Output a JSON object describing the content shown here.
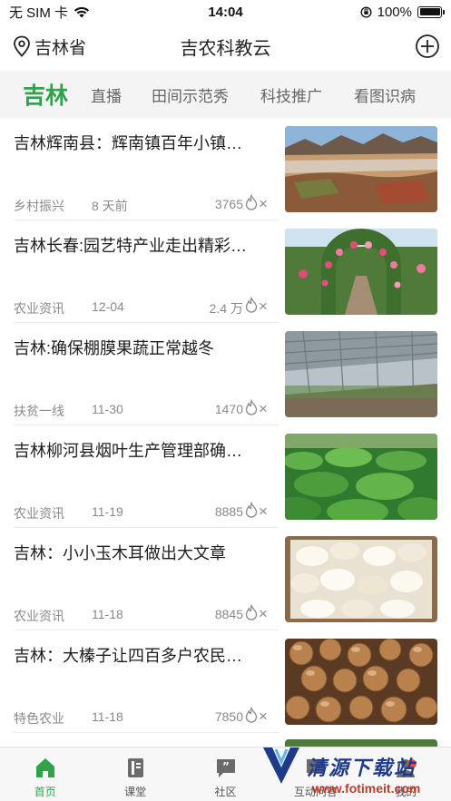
{
  "status_bar": {
    "carrier": "无 SIM 卡",
    "time": "14:04",
    "battery": "100%"
  },
  "header": {
    "location": "吉林省",
    "title": "吉农科教云"
  },
  "tabs": [
    {
      "label": "吉林",
      "active": true
    },
    {
      "label": "直播",
      "active": false
    },
    {
      "label": "田间示范秀",
      "active": false
    },
    {
      "label": "科技推广",
      "active": false
    },
    {
      "label": "看图识病",
      "active": false
    }
  ],
  "articles": [
    {
      "title": "吉林辉南县：辉南镇百年小镇…",
      "category": "乡村振兴",
      "date": "8 天前",
      "views": "3765",
      "image": "mountain-village"
    },
    {
      "title": "吉林长春:园艺特产业走出精彩…",
      "category": "农业资讯",
      "date": "12-04",
      "views": "2.4 万",
      "image": "flower-garden"
    },
    {
      "title": "吉林:确保棚膜果蔬正常越冬",
      "category": "扶贫一线",
      "date": "11-30",
      "views": "1470",
      "image": "greenhouse"
    },
    {
      "title": "吉林柳河县烟叶生产管理部确…",
      "category": "农业资讯",
      "date": "11-19",
      "views": "8885",
      "image": "tobacco-field"
    },
    {
      "title": "吉林：小小玉木耳做出大文章",
      "category": "农业资讯",
      "date": "11-18",
      "views": "8845",
      "image": "white-fungus"
    },
    {
      "title": "吉林：大榛子让四百多户农民…",
      "category": "特色农业",
      "date": "11-18",
      "views": "7850",
      "image": "hazelnuts"
    }
  ],
  "bottom_nav": [
    {
      "label": "首页",
      "icon": "home-icon",
      "active": true
    },
    {
      "label": "课堂",
      "icon": "book-icon",
      "active": false
    },
    {
      "label": "社区",
      "icon": "chat-icon",
      "active": false
    },
    {
      "label": "互动问答",
      "icon": "qa-icon",
      "active": false
    },
    {
      "label": "我的",
      "icon": "user-icon",
      "active": false
    }
  ],
  "watermark": {
    "text": "清源下载站",
    "url": "www.fotimeit.com"
  },
  "colors": {
    "accent": "#2ea34a",
    "muted_text": "#8a8a8a",
    "tab_bar_bg": "#f4f4f4"
  }
}
